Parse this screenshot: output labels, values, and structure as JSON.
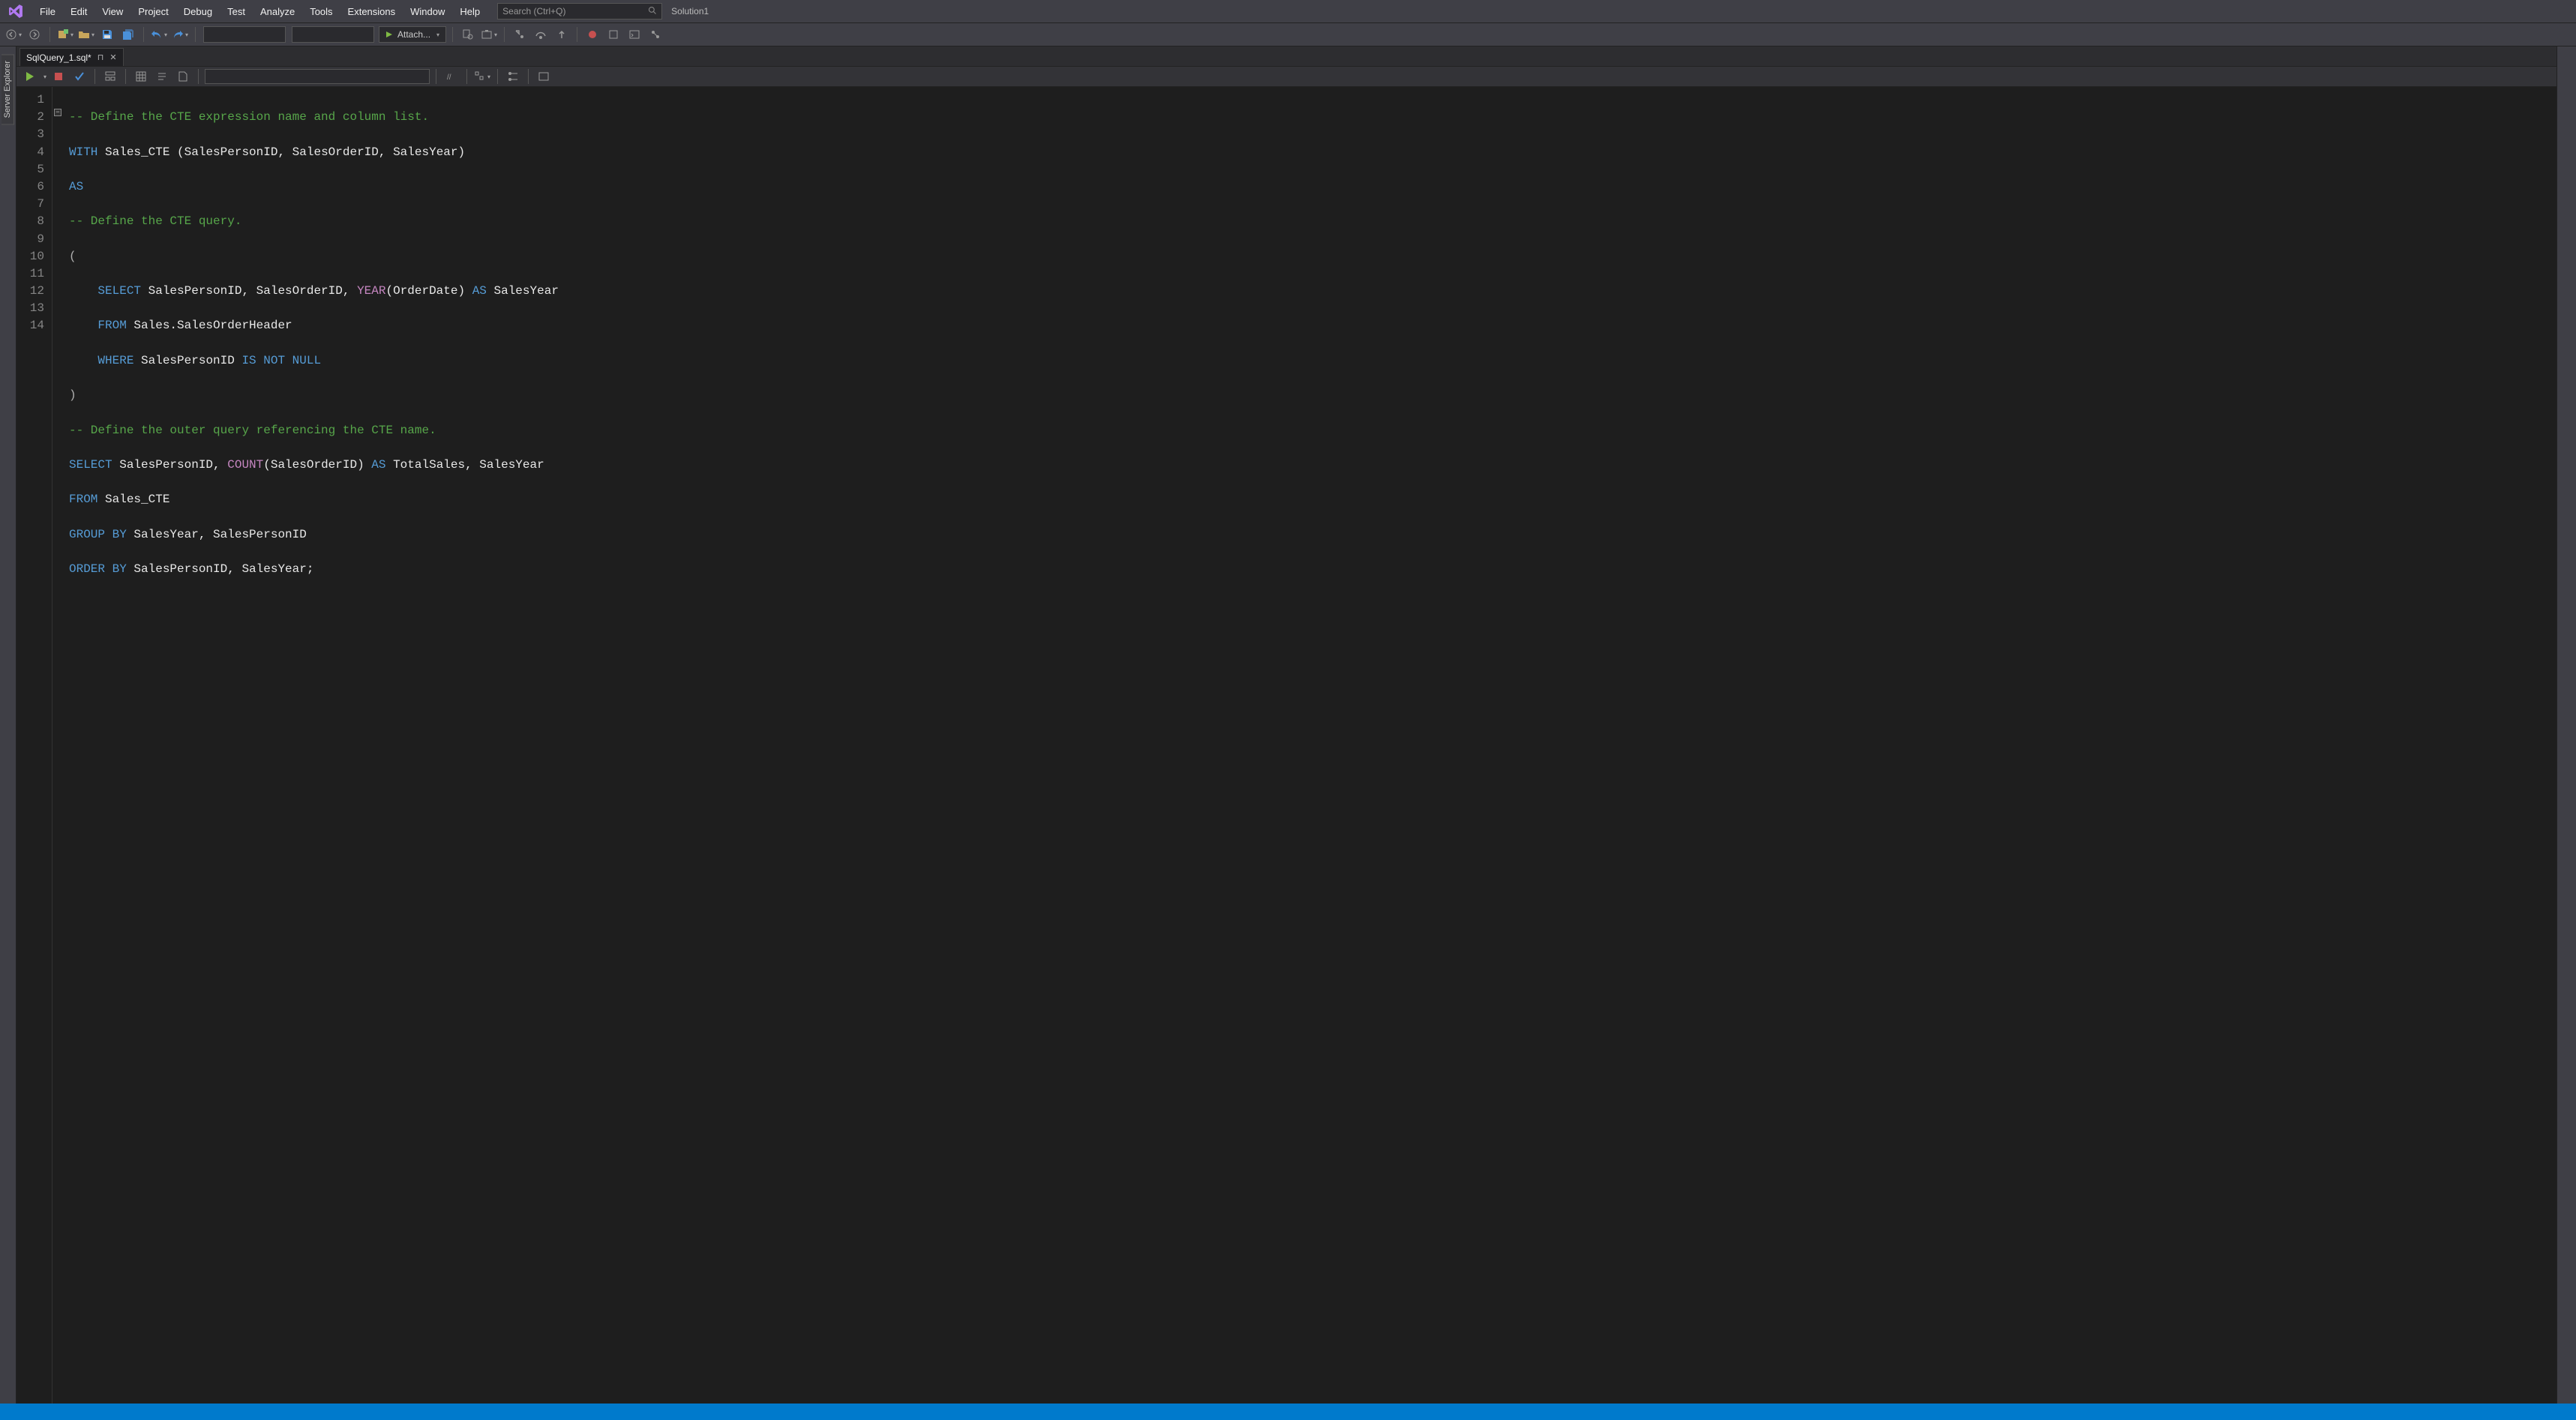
{
  "menubar": {
    "items": [
      "File",
      "Edit",
      "View",
      "Project",
      "Debug",
      "Test",
      "Analyze",
      "Tools",
      "Extensions",
      "Window",
      "Help"
    ],
    "search_placeholder": "Search (Ctrl+Q)",
    "solution_label": "Solution1"
  },
  "toolbar": {
    "attach_label": "Attach..."
  },
  "sidedock": {
    "server_explorer": "Server Explorer"
  },
  "doctab": {
    "filename": "SqlQuery_1.sql*"
  },
  "code": {
    "line_numbers": [
      "1",
      "2",
      "3",
      "4",
      "5",
      "6",
      "7",
      "8",
      "9",
      "10",
      "11",
      "12",
      "13",
      "14"
    ],
    "l1_comment": "-- Define the CTE expression name and column list.",
    "l2_with": "WITH",
    "l2_name": " Sales_CTE ",
    "l2_cols": "(SalesPersonID, SalesOrderID, SalesYear)",
    "l3_as": "AS",
    "l4_comment": "-- Define the CTE query.",
    "l5_paren": "(",
    "l6_select": "SELECT",
    "l6_cols": " SalesPersonID, SalesOrderID, ",
    "l6_year": "YEAR",
    "l6_yarg": "(OrderDate)",
    "l6_as": " AS ",
    "l6_al": "SalesYear",
    "l7_from": "FROM",
    "l7_tbl": " Sales.SalesOrderHeader",
    "l8_where": "WHERE",
    "l8_col": " SalesPersonID ",
    "l8_is": "IS NOT NULL",
    "l9_paren": ")",
    "l10_comment": "-- Define the outer query referencing the CTE name.",
    "l11_select": "SELECT",
    "l11_a": " SalesPersonID, ",
    "l11_count": "COUNT",
    "l11_carg": "(SalesOrderID)",
    "l11_as": " AS ",
    "l11_al1": "TotalSales",
    "l11_comma": ", ",
    "l11_al2": "SalesYear",
    "l12_from": "FROM",
    "l12_tbl": " Sales_CTE",
    "l13_group": "GROUP BY",
    "l13_cols": " SalesYear, SalesPersonID",
    "l14_order": "ORDER BY",
    "l14_cols": " SalesPersonID, SalesYear;"
  }
}
